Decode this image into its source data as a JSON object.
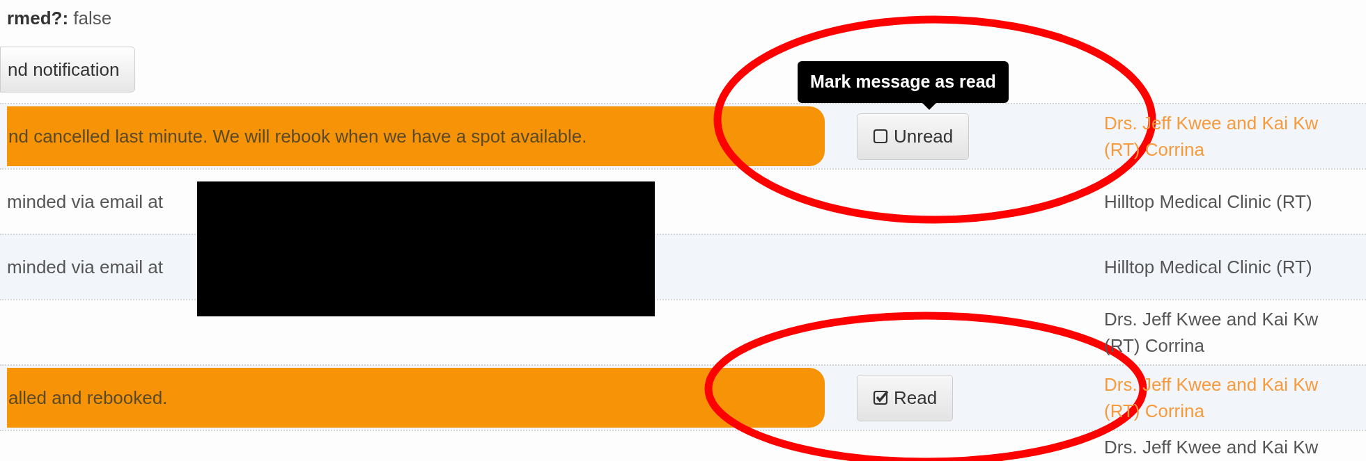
{
  "header": {
    "label": "rmed?:",
    "value": "false"
  },
  "send_button": "nd notification",
  "messages": [
    {
      "text": "nd cancelled last minute. We will rebook when we have a spot available.",
      "highlighted": true,
      "read_button": {
        "label": "Unread",
        "checked": false,
        "tooltip": "Mark message as read"
      },
      "sender": [
        "Drs. Jeff Kwee and Kai Kw",
        "(RT) Corrina"
      ]
    },
    {
      "text": "minded via email at",
      "highlighted": false,
      "sender": [
        "Hilltop Medical Clinic (RT)"
      ]
    },
    {
      "text": "minded via email at",
      "highlighted": false,
      "sender": [
        "Hilltop Medical Clinic (RT)"
      ]
    },
    {
      "highlighted": false,
      "sender": [
        "Drs. Jeff Kwee and Kai Kw",
        "(RT) Corrina"
      ]
    },
    {
      "text": "alled and rebooked.",
      "highlighted": true,
      "read_button": {
        "label": "Read",
        "checked": true
      },
      "sender": [
        "Drs. Jeff Kwee and Kai Kw",
        "(RT) Corrina"
      ]
    },
    {
      "highlighted": false,
      "sender": [
        "Drs. Jeff Kwee and Kai Kw"
      ]
    }
  ]
}
